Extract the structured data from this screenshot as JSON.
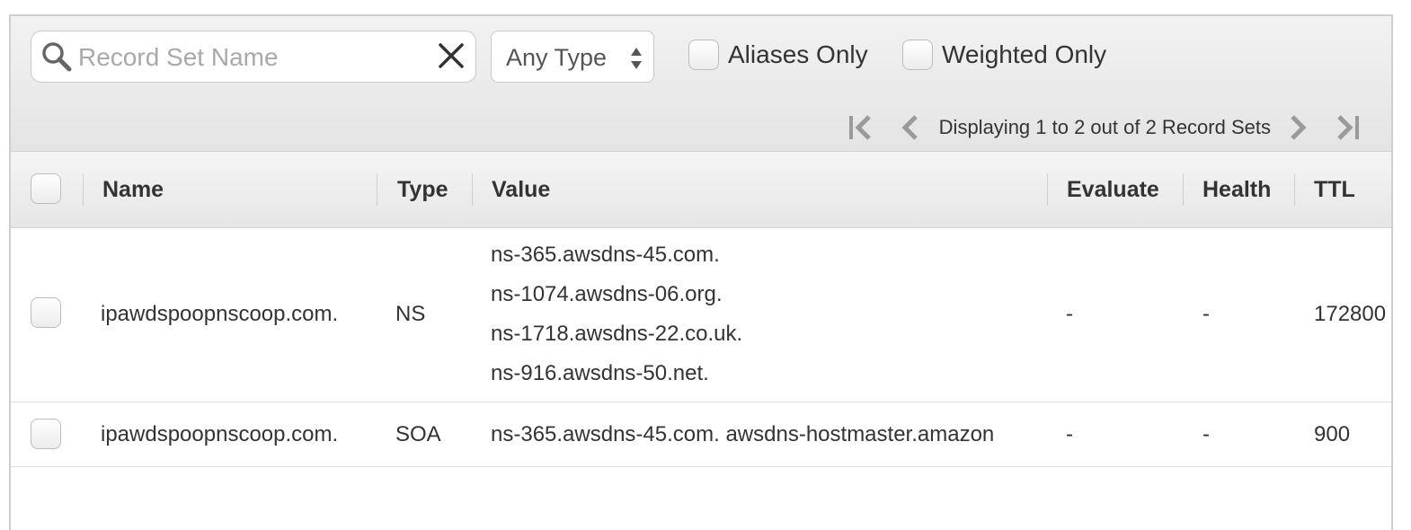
{
  "toolbar": {
    "search_placeholder": "Record Set Name",
    "type_select": "Any Type",
    "aliases_only": "Aliases Only",
    "weighted_only": "Weighted Only"
  },
  "pagination": {
    "text": "Displaying 1 to 2 out of 2 Record Sets"
  },
  "table": {
    "columns": {
      "name": "Name",
      "type": "Type",
      "value": "Value",
      "evaluate": "Evaluate",
      "health": "Health",
      "ttl": "TTL"
    },
    "rows": [
      {
        "name": "ipawdspoopnscoop.com.",
        "type": "NS",
        "values": [
          "ns-365.awsdns-45.com.",
          "ns-1074.awsdns-06.org.",
          "ns-1718.awsdns-22.co.uk.",
          "ns-916.awsdns-50.net."
        ],
        "evaluate": "-",
        "health": "-",
        "ttl": "172800"
      },
      {
        "name": "ipawdspoopnscoop.com.",
        "type": "SOA",
        "values": [
          "ns-365.awsdns-45.com. awsdns-hostmaster.amazon"
        ],
        "evaluate": "-",
        "health": "-",
        "ttl": "900"
      }
    ]
  },
  "icons": {
    "search": "magnifier-icon",
    "clear": "close-x-icon",
    "select": "up-down-arrows-icon",
    "first": "first-page-icon",
    "prev": "previous-page-icon",
    "next": "next-page-icon",
    "last": "last-page-icon"
  },
  "colors": {
    "toolbar_bg": "#e8e8e8",
    "text": "#333333",
    "placeholder": "#a9a9a9",
    "border": "#cfcfcf"
  }
}
